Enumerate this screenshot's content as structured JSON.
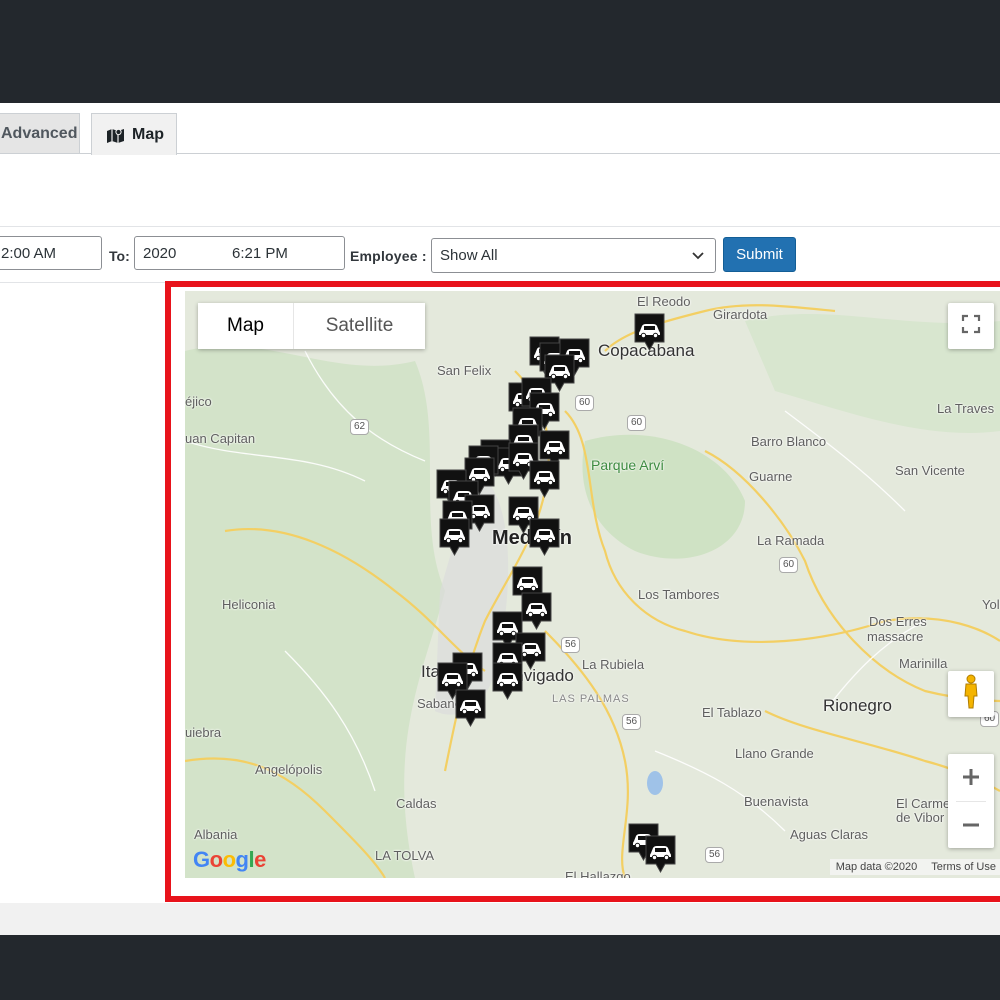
{
  "tabs": [
    {
      "label": "Advanced"
    },
    {
      "label": "Map",
      "icon": "map-icon"
    }
  ],
  "filters": {
    "from_value": "2:00 AM",
    "to_label": "To:",
    "to_date": "2020",
    "to_time": "6:21 PM",
    "employee_label": "Employee :",
    "employee_selected": "Show All",
    "submit_label": "Submit"
  },
  "map": {
    "type_controls": [
      "Map",
      "Satellite"
    ],
    "active_type": "Map",
    "logo": "Google",
    "map_data": "Map data ©2020",
    "terms": "Terms of Use",
    "highlight_color": "#e8131b",
    "places": [
      {
        "name": "El Reodo",
        "cls": ""
      },
      {
        "name": "Girardota",
        "cls": ""
      },
      {
        "name": "Copacabana",
        "cls": "big"
      },
      {
        "name": "San Felix",
        "cls": ""
      },
      {
        "name": "éjico",
        "cls": ""
      },
      {
        "name": "uan Capitan",
        "cls": ""
      },
      {
        "name": "La Traves",
        "cls": ""
      },
      {
        "name": "Barro Blanco",
        "cls": ""
      },
      {
        "name": "Parque Arví",
        "cls": "green"
      },
      {
        "name": "Guarne",
        "cls": ""
      },
      {
        "name": "San Vicente",
        "cls": ""
      },
      {
        "name": "Medellín",
        "cls": "city"
      },
      {
        "name": "La Ramada",
        "cls": ""
      },
      {
        "name": "Heliconia",
        "cls": ""
      },
      {
        "name": "Los Tambores",
        "cls": ""
      },
      {
        "name": "Dos Erres",
        "cls": ""
      },
      {
        "name": "massacre",
        "cls": ""
      },
      {
        "name": "Yol",
        "cls": ""
      },
      {
        "name": "La Rubiela",
        "cls": ""
      },
      {
        "name": "Marinilla",
        "cls": ""
      },
      {
        "name": "Itagüí",
        "cls": "big"
      },
      {
        "name": "Envigado",
        "cls": "big"
      },
      {
        "name": "LAS PALMAS",
        "cls": "dim"
      },
      {
        "name": "Sabaneta",
        "cls": ""
      },
      {
        "name": "Rionegro",
        "cls": "big"
      },
      {
        "name": "El Tablazo",
        "cls": ""
      },
      {
        "name": "uiebra",
        "cls": ""
      },
      {
        "name": "Llano Grande",
        "cls": ""
      },
      {
        "name": "Angelópolis",
        "cls": ""
      },
      {
        "name": "Caldas",
        "cls": ""
      },
      {
        "name": "Buenavista",
        "cls": ""
      },
      {
        "name": "El Carme",
        "cls": ""
      },
      {
        "name": "de Vibor",
        "cls": ""
      },
      {
        "name": "Albania",
        "cls": ""
      },
      {
        "name": "Aguas Claras",
        "cls": ""
      },
      {
        "name": "LA TOLVA",
        "cls": ""
      },
      {
        "name": "El Hallazgo",
        "cls": ""
      }
    ],
    "road_shields": [
      "62",
      "60",
      "60",
      "56",
      "56",
      "60",
      "56",
      "60"
    ]
  }
}
